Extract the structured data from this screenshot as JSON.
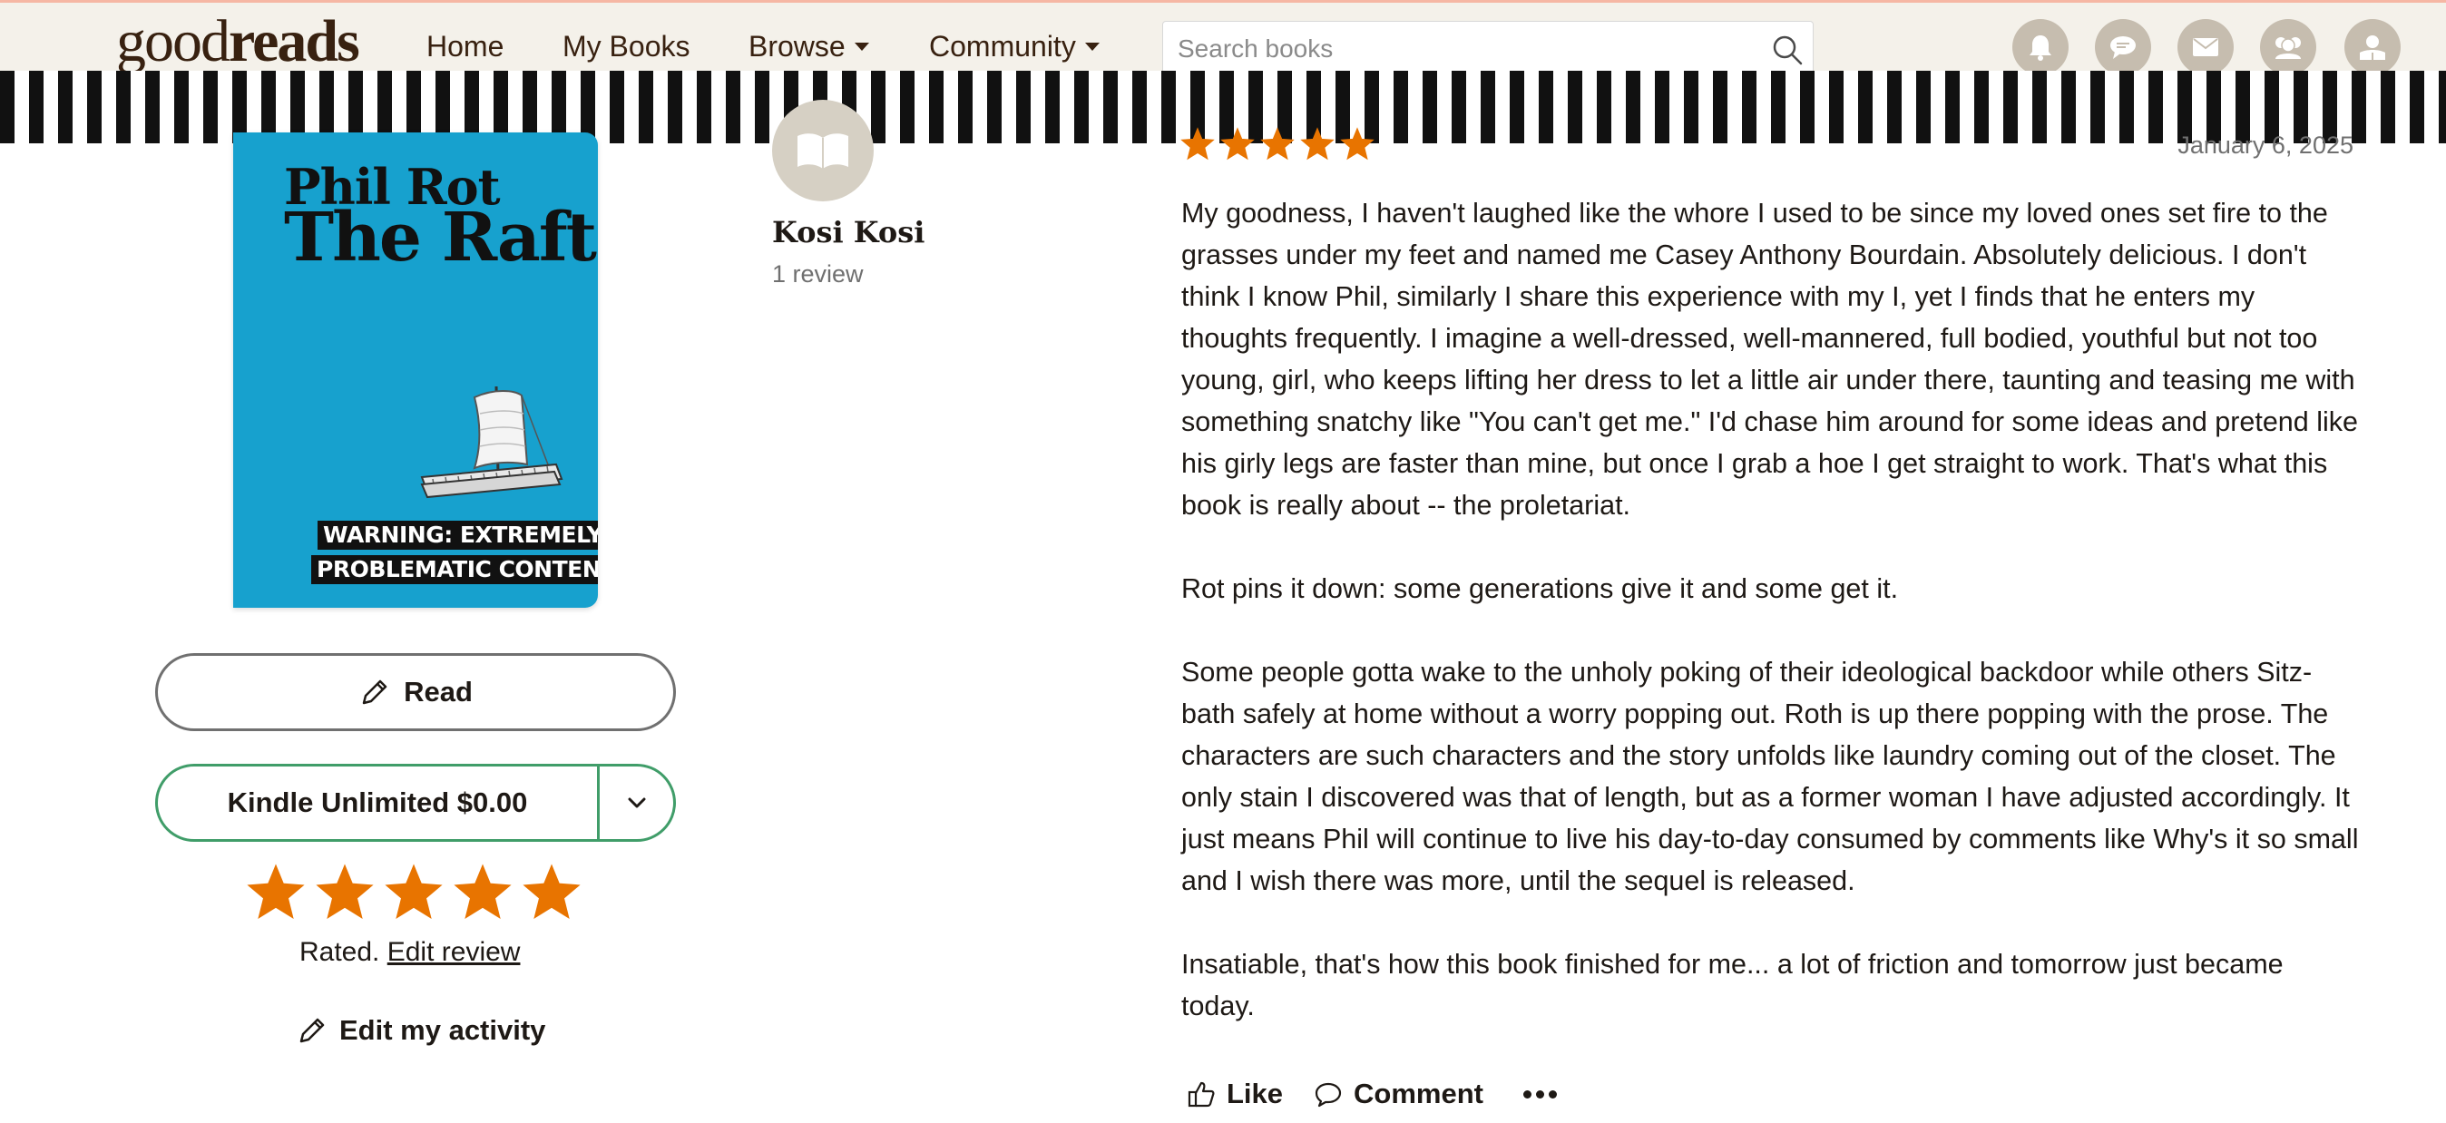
{
  "nav": {
    "logo_part1": "good",
    "logo_part2": "reads",
    "home": "Home",
    "my_books": "My Books",
    "browse": "Browse",
    "community": "Community",
    "search_placeholder": "Search books",
    "icons": [
      "bell-icon",
      "chat-icon",
      "mail-icon",
      "friends-icon",
      "profile-icon"
    ]
  },
  "book": {
    "cover_author": "Phil Rot",
    "cover_title": "The Raft",
    "cover_warning_line1": "WARNING: EXTREMELY",
    "cover_warning_line2": "PROBLEMATIC CONTENT",
    "cover_color": "#17a1ce",
    "read_label": "Read",
    "kindle_label": "Kindle Unlimited $0.00",
    "my_rating": 5,
    "rated_label": "Rated.",
    "edit_review_label": "Edit review",
    "edit_activity_label": "Edit my activity"
  },
  "reviewer": {
    "name": "Kosi Kosi",
    "review_count": "1 review"
  },
  "review": {
    "rating": 5,
    "date": "January 6, 2025",
    "paragraphs": [
      "My goodness, I haven't laughed like the whore I used to be since my loved ones set fire to the grasses under my feet and named me Casey Anthony Bourdain. Absolutely delicious. I don't think I know Phil, similarly I share this experience with my I, yet I finds that he enters my thoughts frequently. I imagine a well-dressed, well-mannered, full bodied, youthful but not too young, girl, who keeps lifting her dress to let a little air under there, taunting and teasing me with something snatchy like \"You can't get me.\" I'd chase him around for some ideas and pretend like his girly legs are faster than mine, but once I grab a hoe I get straight to work. That's what this book is really about -- the proletariat.",
      "Rot pins it down: some generations give it and some get it.",
      "Some people gotta wake to the unholy poking of their ideological backdoor while others Sitz-bath safely at home without a worry popping out. Roth is up there popping with the prose. The characters are such characters and the story unfolds like laundry coming out of the closet. The only stain I discovered was that of length, but as a former woman I have adjusted accordingly. It just means Phil will continue to live his day-to-day consumed by comments like Why's it so small and I wish there was more, until the sequel is released.",
      "Insatiable, that's how this book finished for me... a lot of friction and tomorrow just became today."
    ],
    "like_label": "Like",
    "comment_label": "Comment"
  },
  "colors": {
    "nav_bg": "#f4f1ea",
    "brand_brown": "#382110",
    "star_orange": "#e87400",
    "kindle_green": "#409d69"
  }
}
